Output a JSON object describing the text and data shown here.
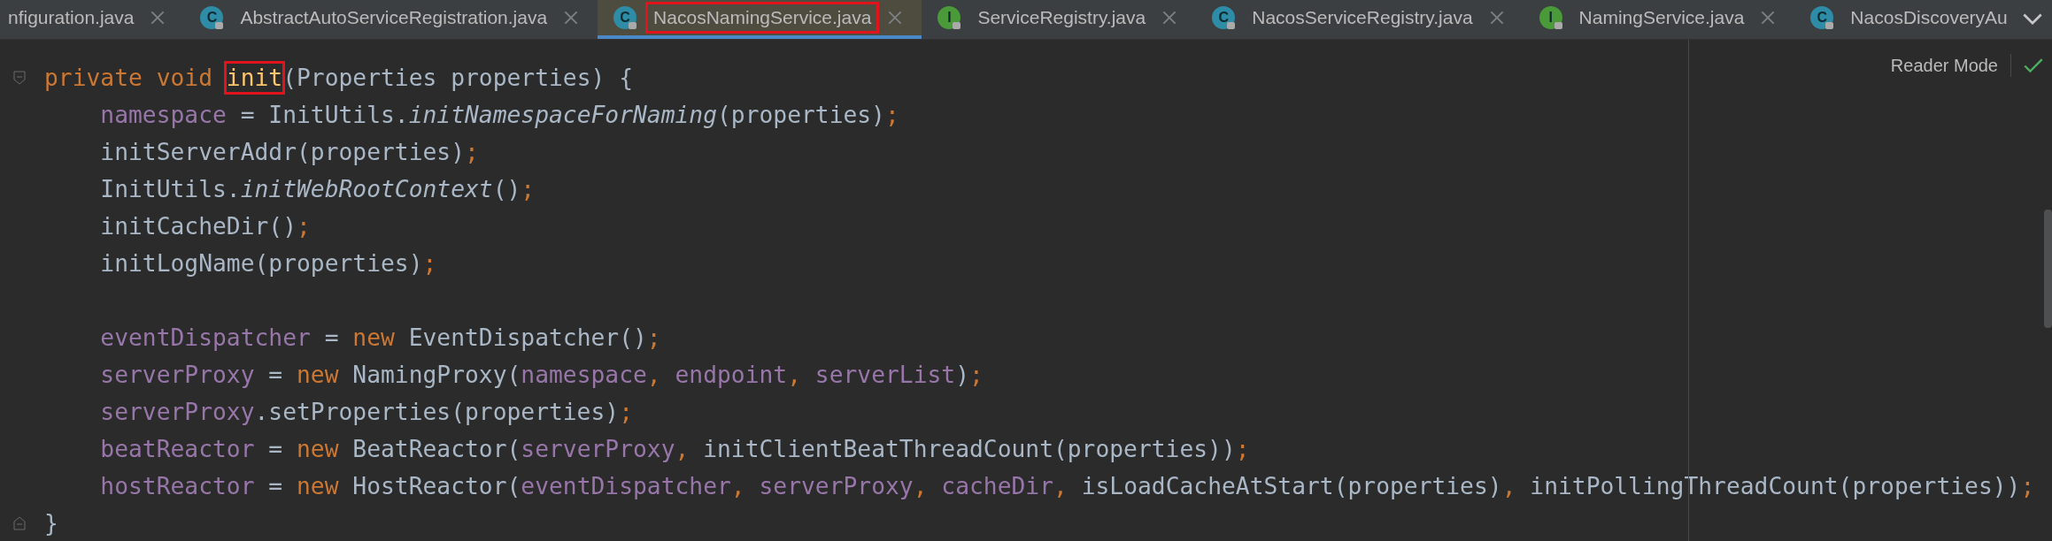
{
  "tabs": [
    {
      "label": "nfiguration.java",
      "kind": "plain",
      "selected": false,
      "closable": true,
      "highlighted": false
    },
    {
      "label": "AbstractAutoServiceRegistration.java",
      "kind": "class",
      "icon_letter": "C",
      "selected": false,
      "closable": true,
      "highlighted": false
    },
    {
      "label": "NacosNamingService.java",
      "kind": "class",
      "icon_letter": "C",
      "selected": true,
      "closable": true,
      "highlighted": true
    },
    {
      "label": "ServiceRegistry.java",
      "kind": "interface",
      "icon_letter": "I",
      "selected": false,
      "closable": true,
      "highlighted": false
    },
    {
      "label": "NacosServiceRegistry.java",
      "kind": "class",
      "icon_letter": "C",
      "selected": false,
      "closable": true,
      "highlighted": false
    },
    {
      "label": "NamingService.java",
      "kind": "interface",
      "icon_letter": "I",
      "selected": false,
      "closable": true,
      "highlighted": false
    },
    {
      "label": "NacosDiscoveryAu",
      "kind": "class",
      "icon_letter": "C",
      "selected": false,
      "closable": false,
      "highlighted": false
    }
  ],
  "reader_mode": "Reader Mode",
  "method": {
    "header": [
      {
        "kind": "keyword",
        "text": "private void "
      },
      {
        "kind": "declaration",
        "text": "init",
        "highlighted": true
      },
      {
        "kind": "plain",
        "text": "(Properties properties) {"
      }
    ],
    "children": [
      {
        "kind": "code",
        "tokens": [
          {
            "kind": "field",
            "text": "namespace"
          },
          {
            "kind": "plain",
            "text": " = InitUtils."
          },
          {
            "kind": "static",
            "text": "initNamespaceForNaming"
          },
          {
            "kind": "plain",
            "text": "(properties)"
          },
          {
            "kind": "punct",
            "text": ";"
          }
        ]
      },
      {
        "kind": "code",
        "tokens": [
          {
            "kind": "plain",
            "text": "initServerAddr(properties)"
          },
          {
            "kind": "punct",
            "text": ";"
          }
        ]
      },
      {
        "kind": "code",
        "tokens": [
          {
            "kind": "plain",
            "text": "InitUtils."
          },
          {
            "kind": "static",
            "text": "initWebRootContext"
          },
          {
            "kind": "plain",
            "text": "()"
          },
          {
            "kind": "punct",
            "text": ";"
          }
        ]
      },
      {
        "kind": "code",
        "tokens": [
          {
            "kind": "plain",
            "text": "initCacheDir()"
          },
          {
            "kind": "punct",
            "text": ";"
          }
        ]
      },
      {
        "kind": "code",
        "tokens": [
          {
            "kind": "plain",
            "text": "initLogName(properties)"
          },
          {
            "kind": "punct",
            "text": ";"
          }
        ]
      },
      {
        "kind": "blank"
      },
      {
        "kind": "code",
        "tokens": [
          {
            "kind": "field",
            "text": "eventDispatcher"
          },
          {
            "kind": "plain",
            "text": " = "
          },
          {
            "kind": "keyword",
            "text": "new "
          },
          {
            "kind": "plain",
            "text": "EventDispatcher()"
          },
          {
            "kind": "punct",
            "text": ";"
          }
        ]
      },
      {
        "kind": "code",
        "tokens": [
          {
            "kind": "field",
            "text": "serverProxy"
          },
          {
            "kind": "plain",
            "text": " = "
          },
          {
            "kind": "keyword",
            "text": "new "
          },
          {
            "kind": "plain",
            "text": "NamingProxy("
          },
          {
            "kind": "field",
            "text": "namespace"
          },
          {
            "kind": "punct",
            "text": ", "
          },
          {
            "kind": "field",
            "text": "endpoint"
          },
          {
            "kind": "punct",
            "text": ", "
          },
          {
            "kind": "field",
            "text": "serverList"
          },
          {
            "kind": "plain",
            "text": ")"
          },
          {
            "kind": "punct",
            "text": ";"
          }
        ]
      },
      {
        "kind": "code",
        "tokens": [
          {
            "kind": "field",
            "text": "serverProxy"
          },
          {
            "kind": "plain",
            "text": ".setProperties(properties)"
          },
          {
            "kind": "punct",
            "text": ";"
          }
        ]
      },
      {
        "kind": "code",
        "tokens": [
          {
            "kind": "field",
            "text": "beatReactor"
          },
          {
            "kind": "plain",
            "text": " = "
          },
          {
            "kind": "keyword",
            "text": "new "
          },
          {
            "kind": "plain",
            "text": "BeatReactor("
          },
          {
            "kind": "field",
            "text": "serverProxy"
          },
          {
            "kind": "punct",
            "text": ", "
          },
          {
            "kind": "plain",
            "text": "initClientBeatThreadCount(properties))"
          },
          {
            "kind": "punct",
            "text": ";"
          }
        ]
      },
      {
        "kind": "code",
        "tokens": [
          {
            "kind": "field",
            "text": "hostReactor"
          },
          {
            "kind": "plain",
            "text": " = "
          },
          {
            "kind": "keyword",
            "text": "new "
          },
          {
            "kind": "plain",
            "text": "HostReactor("
          },
          {
            "kind": "field",
            "text": "eventDispatcher"
          },
          {
            "kind": "punct",
            "text": ", "
          },
          {
            "kind": "field",
            "text": "serverProxy"
          },
          {
            "kind": "punct",
            "text": ", "
          },
          {
            "kind": "field",
            "text": "cacheDir"
          },
          {
            "kind": "punct",
            "text": ", "
          },
          {
            "kind": "plain",
            "text": "isLoadCacheAtStart(properties)"
          },
          {
            "kind": "punct",
            "text": ", "
          },
          {
            "kind": "plain",
            "text": "initPollingThreadCount(properties))"
          },
          {
            "kind": "punct",
            "text": ";"
          }
        ]
      }
    ],
    "footer": [
      {
        "kind": "plain",
        "text": "}"
      }
    ]
  }
}
